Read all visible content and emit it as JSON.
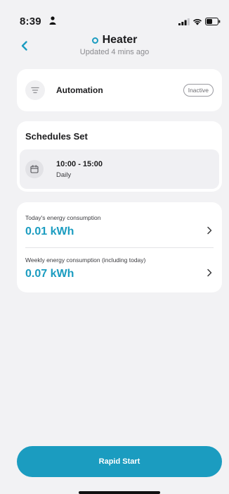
{
  "status_bar": {
    "time": "8:39"
  },
  "header": {
    "title": "Heater",
    "subtitle": "Updated 4 mins ago"
  },
  "automation": {
    "label": "Automation",
    "badge": "Inactive"
  },
  "schedules": {
    "heading": "Schedules Set",
    "items": [
      {
        "time": "10:00 - 15:00",
        "frequency": "Daily"
      }
    ]
  },
  "energy": {
    "rows": [
      {
        "label": "Today's energy consumption",
        "value": "0.01 kWh"
      },
      {
        "label": "Weekly energy consumption (including today)",
        "value": "0.07 kWh"
      }
    ]
  },
  "actions": {
    "rapid_start_label": "Rapid Start"
  },
  "colors": {
    "accent": "#1b9cc0",
    "background": "#f2f2f4"
  },
  "icons": {
    "back": "chevron-left-icon",
    "automation": "filter-lines-icon",
    "schedule": "calendar-icon",
    "row_chevron": "chevron-right-icon"
  }
}
